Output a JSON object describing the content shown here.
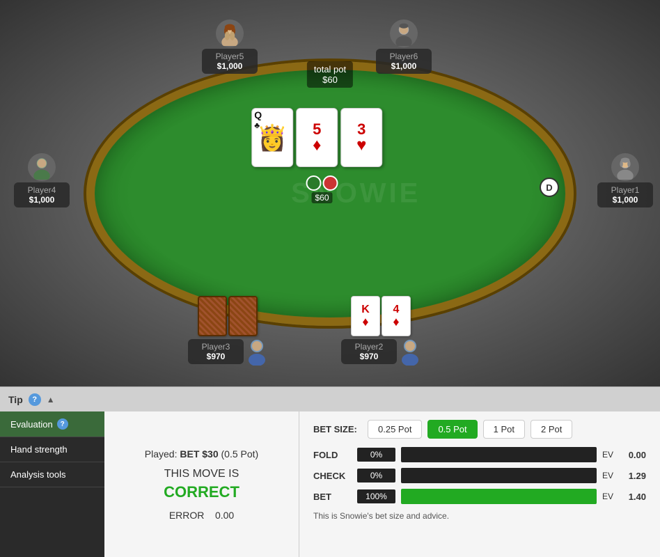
{
  "table": {
    "total_pot_label": "total pot",
    "total_pot_value": "$60",
    "watermark": "SNOWIE"
  },
  "players": [
    {
      "id": "player5",
      "name": "Player5",
      "stack": "$1,000",
      "position": "top-left",
      "avatar": "female"
    },
    {
      "id": "player6",
      "name": "Player6",
      "stack": "$1,000",
      "position": "top-right",
      "avatar": "male"
    },
    {
      "id": "player4",
      "name": "Player4",
      "stack": "$1,000",
      "position": "left",
      "avatar": "male-green"
    },
    {
      "id": "player1",
      "name": "Player1",
      "stack": "$1,000",
      "position": "right",
      "avatar": "female-gray"
    },
    {
      "id": "player3",
      "name": "Player3",
      "stack": "$970",
      "position": "bottom-left",
      "avatar": "male-blue",
      "cards": "back"
    },
    {
      "id": "player2",
      "name": "Player2",
      "stack": "$970",
      "position": "bottom-right",
      "avatar": "male-blue2",
      "cards": "KD-4D"
    }
  ],
  "community_cards": [
    {
      "rank": "Q",
      "suit": "♣",
      "color": "black"
    },
    {
      "rank": "5",
      "suit": "♦",
      "color": "red"
    },
    {
      "rank": "3",
      "suit": "♥",
      "color": "red"
    }
  ],
  "pot": {
    "amount": "$60"
  },
  "dealer": "D",
  "evaluation": {
    "played_label": "Played:",
    "played_action": "BET $30",
    "played_detail": "(0.5 Pot)",
    "move_label": "THIS MOVE IS",
    "correct_label": "CORRECT",
    "error_label": "ERROR",
    "error_value": "0.00"
  },
  "bet_size": {
    "label": "BET SIZE:",
    "options": [
      {
        "label": "0.25 Pot",
        "active": false
      },
      {
        "label": "0.5 Pot",
        "active": true
      },
      {
        "label": "1 Pot",
        "active": false
      },
      {
        "label": "2 Pot",
        "active": false
      }
    ]
  },
  "actions": [
    {
      "label": "FOLD",
      "pct": "0%",
      "bar": 0,
      "ev_label": "EV",
      "ev_value": "0.00"
    },
    {
      "label": "CHECK",
      "pct": "0%",
      "bar": 0,
      "ev_label": "EV",
      "ev_value": "1.29"
    },
    {
      "label": "BET",
      "pct": "100%",
      "bar": 100,
      "ev_label": "EV",
      "ev_value": "1.40"
    }
  ],
  "snowie_advice": "This is Snowie's bet size and advice.",
  "sidebar": {
    "items": [
      {
        "id": "evaluation",
        "label": "Evaluation",
        "active": true,
        "has_help": true
      },
      {
        "id": "hand-strength",
        "label": "Hand strength",
        "active": false,
        "has_help": false
      },
      {
        "id": "analysis-tools",
        "label": "Analysis tools",
        "active": false,
        "has_help": false
      }
    ]
  },
  "tip_bar": {
    "label": "Tip"
  }
}
